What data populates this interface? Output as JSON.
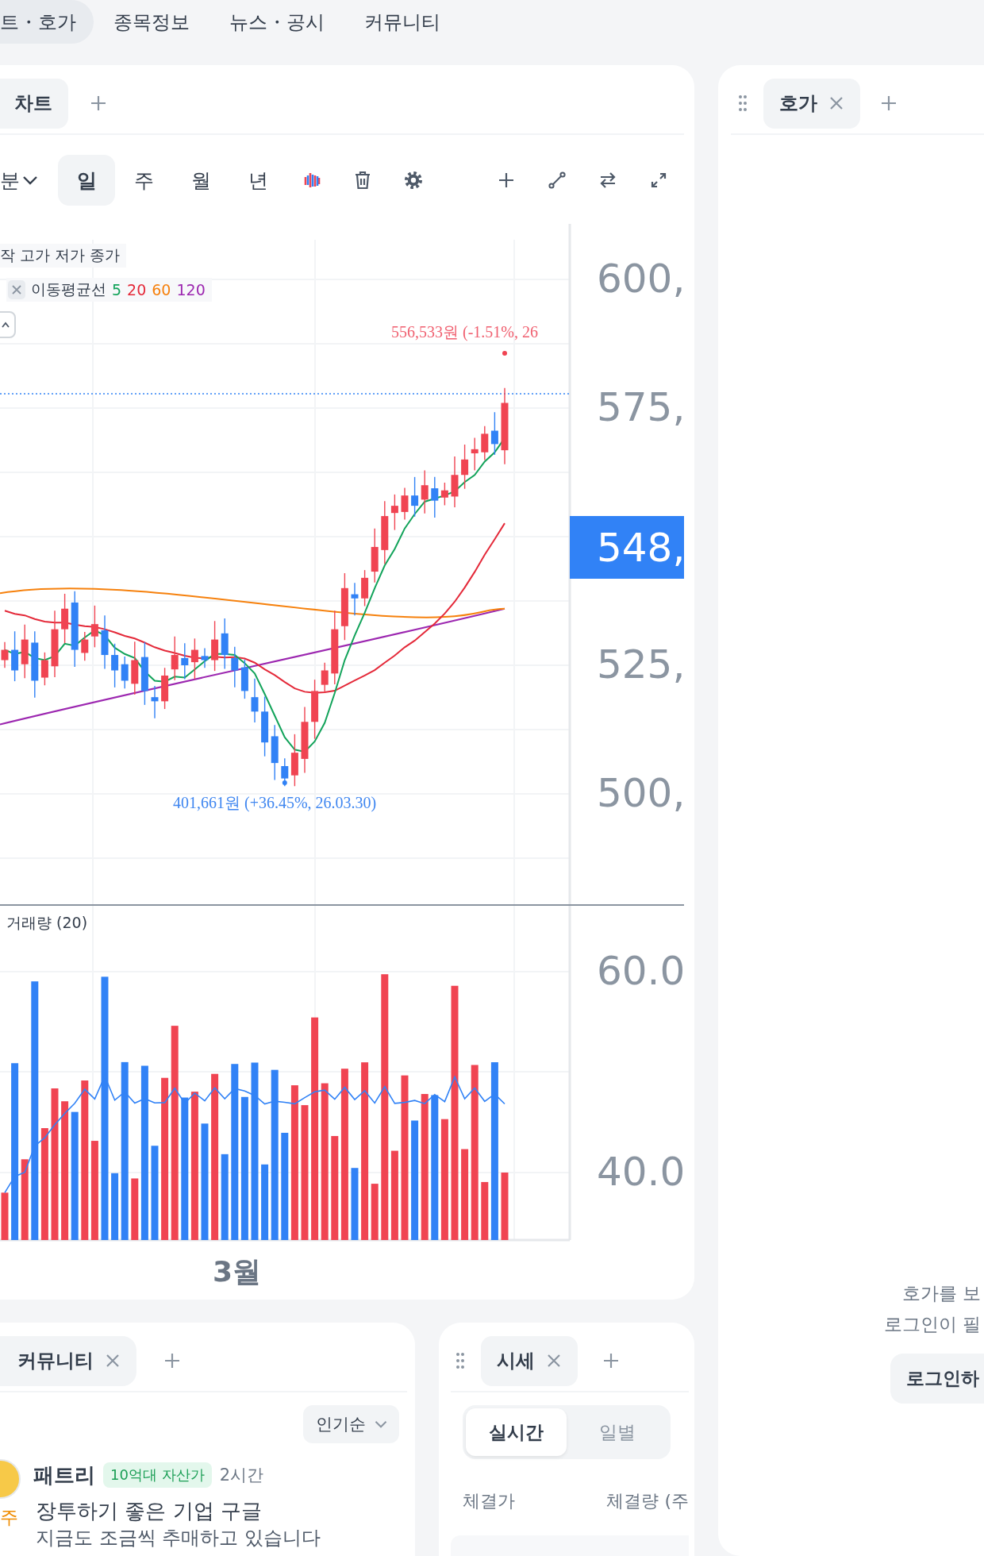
{
  "top_nav": {
    "items": [
      {
        "label": "트・호가",
        "selected": true
      },
      {
        "label": "종목정보",
        "selected": false
      },
      {
        "label": "뉴스・공시",
        "selected": false
      },
      {
        "label": "커뮤니티",
        "selected": false
      }
    ]
  },
  "chart_panel": {
    "tabs": [
      {
        "label": "차트",
        "selected": true,
        "closable": false
      }
    ],
    "periods": [
      {
        "label": "분",
        "kind": "dropdown",
        "selected": false
      },
      {
        "label": "일",
        "kind": "button",
        "selected": true
      },
      {
        "label": "주",
        "kind": "button",
        "selected": false
      },
      {
        "label": "월",
        "kind": "button",
        "selected": false
      },
      {
        "label": "년",
        "kind": "button",
        "selected": false
      }
    ],
    "ohlc_legend": "작 고가 저가 종가",
    "moving_average": {
      "label": "이동평균선",
      "periods": [
        {
          "label": "5",
          "color": "#12a35a"
        },
        {
          "label": "20",
          "color": "#e42939"
        },
        {
          "label": "60",
          "color": "#f6810d"
        },
        {
          "label": "120",
          "color": "#9c27b0"
        }
      ]
    },
    "high_annotation": "556,533원 (-1.51%, 26",
    "low_annotation": "401,661원 (+36.45%, 26.03.30)",
    "price_axis": [
      "600,",
      "575,",
      "525,",
      "500,"
    ],
    "current_price": "548,",
    "volume_label": "거래량 (20)",
    "volume_axis": [
      "60.0",
      "40.0"
    ],
    "x_axis_label": "3월"
  },
  "orderbook_panel": {
    "tabs": [
      {
        "label": "호가",
        "selected": true,
        "closable": true
      }
    ],
    "message_lines": [
      "호가를 보",
      "로그인이 필"
    ],
    "login_button": "로그인하"
  },
  "community_panel": {
    "tabs": [
      {
        "label": "커뮤니티",
        "selected": true,
        "closable": true
      }
    ],
    "sort": "인기순",
    "post": {
      "author": "패트리",
      "badge": "10억대 자산가",
      "time": "2시간",
      "avatar_caption": "주",
      "title": "장투하기 좋은 기업 구글",
      "body": "지금도 조금씩 추매하고 있습니다"
    }
  },
  "price_panel": {
    "tabs": [
      {
        "label": "시세",
        "selected": true,
        "closable": true
      }
    ],
    "segments": [
      {
        "label": "실시간",
        "selected": true
      },
      {
        "label": "일별",
        "selected": false
      }
    ],
    "columns": [
      "체결가",
      "체결량 (주"
    ]
  }
}
